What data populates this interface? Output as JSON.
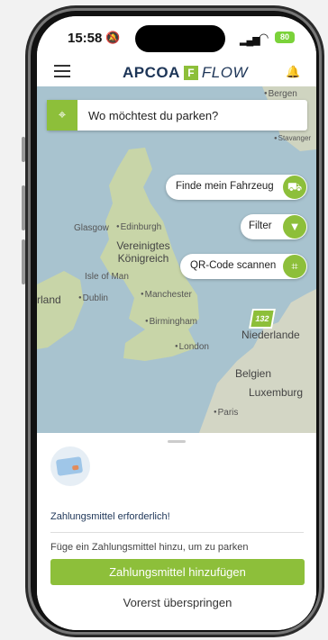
{
  "status_bar": {
    "time": "15:58",
    "battery": "80"
  },
  "header": {
    "brand_left": "APCOA",
    "brand_mark": "F",
    "brand_right": "FLOW"
  },
  "search": {
    "placeholder": "Wo möchtest du parken?"
  },
  "map": {
    "buttons": {
      "find_vehicle": "Finde mein Fahrzeug",
      "filter": "Filter",
      "qr_scan": "QR-Code scannen"
    },
    "parking_marker": "132",
    "labels": {
      "bergen": "Bergen",
      "stavanger": "Stavanger",
      "glasgow": "Glasgow",
      "edinburgh": "Edinburgh",
      "uk": "Vereinigtes Königreich",
      "isle_of_man": "Isle of Man",
      "ireland": "rland",
      "dublin": "Dublin",
      "manchester": "Manchester",
      "birmingham": "Birmingham",
      "london": "London",
      "netherlands": "Niederlande",
      "belgium": "Belgien",
      "luxembourg": "Luxemburg",
      "paris": "Paris"
    }
  },
  "sheet": {
    "payment_required": "Zahlungsmittel erforderlich!",
    "hint": "Füge ein Zahlungsmittel hinzu, um zu parken",
    "add_button": "Zahlungsmittel hinzufügen",
    "skip_button": "Vorerst überspringen"
  }
}
